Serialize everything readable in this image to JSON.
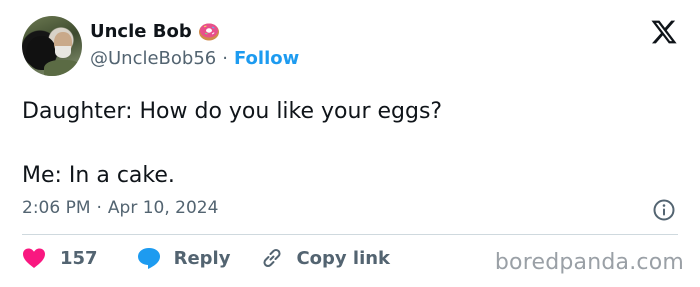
{
  "author": {
    "display_name": "Uncle Bob",
    "name_emoji_icon": "donut-icon",
    "handle": "@UncleBob56",
    "separator": "·",
    "follow_label": "Follow"
  },
  "platform_logo_icon": "x-logo-icon",
  "tweet": {
    "text": "Daughter: How do you like your eggs?\n\nMe: In a cake.",
    "time": "2:06 PM",
    "date_separator": "·",
    "date": "Apr 10, 2024"
  },
  "actions": {
    "like_count": "157",
    "reply_label": "Reply",
    "copy_link_label": "Copy link"
  },
  "watermark": "boredpanda.com",
  "colors": {
    "text_primary": "#0f1419",
    "text_secondary": "#536471",
    "accent_blue": "#1d9bf0",
    "like_red": "#f91880",
    "divider": "#cfd9de"
  }
}
